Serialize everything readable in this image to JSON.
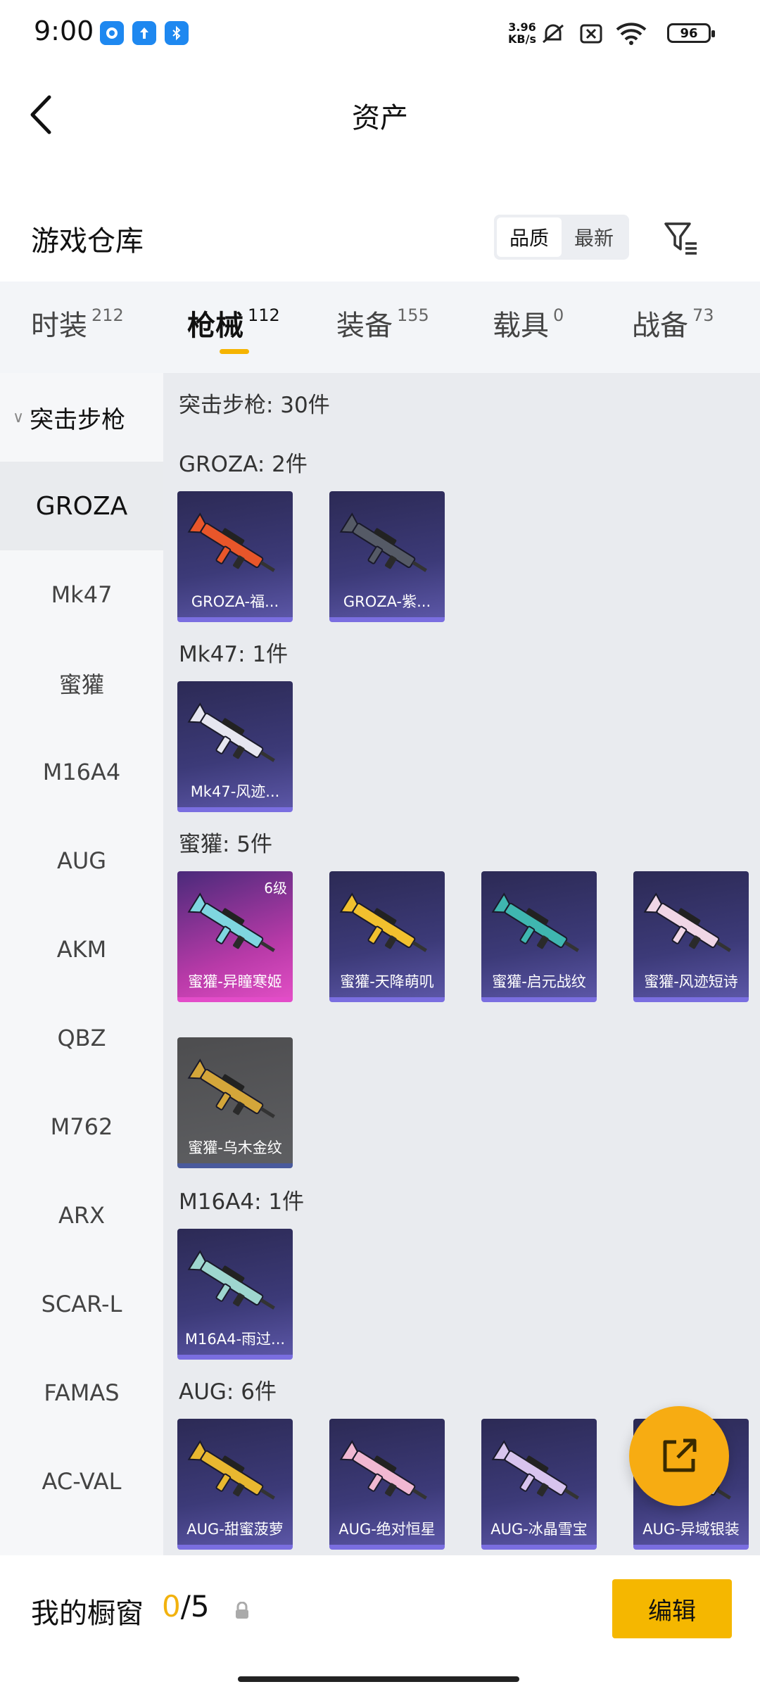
{
  "status_bar": {
    "time": "9:00",
    "net_speed_value": "3.96",
    "net_speed_unit": "KB/s",
    "battery": "96"
  },
  "header": {
    "title": "资产"
  },
  "warehouse": {
    "title": "游戏仓库",
    "sort_quality": "品质",
    "sort_latest": "最新"
  },
  "tabs": [
    {
      "label": "时装",
      "count": "212"
    },
    {
      "label": "枪械",
      "count": "112"
    },
    {
      "label": "装备",
      "count": "155"
    },
    {
      "label": "载具",
      "count": "0"
    },
    {
      "label": "战备",
      "count": "73"
    }
  ],
  "sidebar": {
    "group": "突击步枪",
    "items": [
      "GROZA",
      "Mk47",
      "蜜獾",
      "M16A4",
      "AUG",
      "AKM",
      "QBZ",
      "M762",
      "ARX",
      "SCAR-L",
      "FAMAS",
      "AC-VAL"
    ]
  },
  "content": {
    "category_header": "突击步枪: 30件",
    "sections": [
      {
        "title": "GROZA: 2件",
        "items": [
          {
            "name": "GROZA-福..."
          },
          {
            "name": "GROZA-紫..."
          }
        ]
      },
      {
        "title": "Mk47: 1件",
        "items": [
          {
            "name": "Mk47-风迹..."
          }
        ]
      },
      {
        "title": "蜜獾: 5件",
        "items": [
          {
            "name": "蜜獾-异瞳寒姬",
            "level": "6级"
          },
          {
            "name": "蜜獾-天降萌叽"
          },
          {
            "name": "蜜獾-启元战纹"
          },
          {
            "name": "蜜獾-风迹短诗"
          },
          {
            "name": "蜜獾-乌木金纹"
          }
        ]
      },
      {
        "title": "M16A4: 1件",
        "items": [
          {
            "name": "M16A4-雨过..."
          }
        ]
      },
      {
        "title": "AUG: 6件",
        "items": [
          {
            "name": "AUG-甜蜜菠萝"
          },
          {
            "name": "AUG-绝对恒星"
          },
          {
            "name": "AUG-冰晶雪宝"
          },
          {
            "name": "AUG-异域银装"
          }
        ]
      }
    ]
  },
  "bottom": {
    "window_label": "我的橱窗",
    "window_current": "0",
    "window_total": "/5",
    "edit_label": "编辑"
  },
  "colors": {
    "accent": "#f5b700",
    "card_bg": "#3c3a78",
    "card_legendary": "#e34cc9"
  },
  "icons": {
    "back": "chevron-left-icon",
    "filter": "filter-icon",
    "share": "share-external-icon",
    "lock": "lock-icon"
  }
}
